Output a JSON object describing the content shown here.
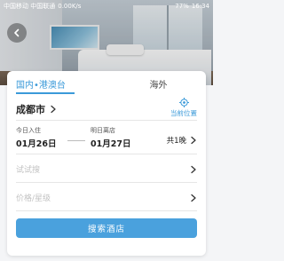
{
  "status_bar": {
    "left": "中国移动 中国联通",
    "speed": "0.00K/s",
    "battery": "77%",
    "time": "16:34"
  },
  "tabs": [
    {
      "label": "国内•港澳台",
      "active": true
    },
    {
      "label": "海外",
      "active": false
    }
  ],
  "search": {
    "city": "成都市",
    "current_location_label": "当前位置",
    "checkin_label": "今日入住",
    "checkin_date": "01月26日",
    "checkout_label": "明日离店",
    "checkout_date": "01月27日",
    "nights": "共1晚",
    "keyword_placeholder": "试试搜",
    "price_placeholder": "价格/星级",
    "submit_label": "搜索酒店"
  },
  "colors": {
    "accent": "#3b9ad9",
    "button": "#4aa1dd"
  }
}
